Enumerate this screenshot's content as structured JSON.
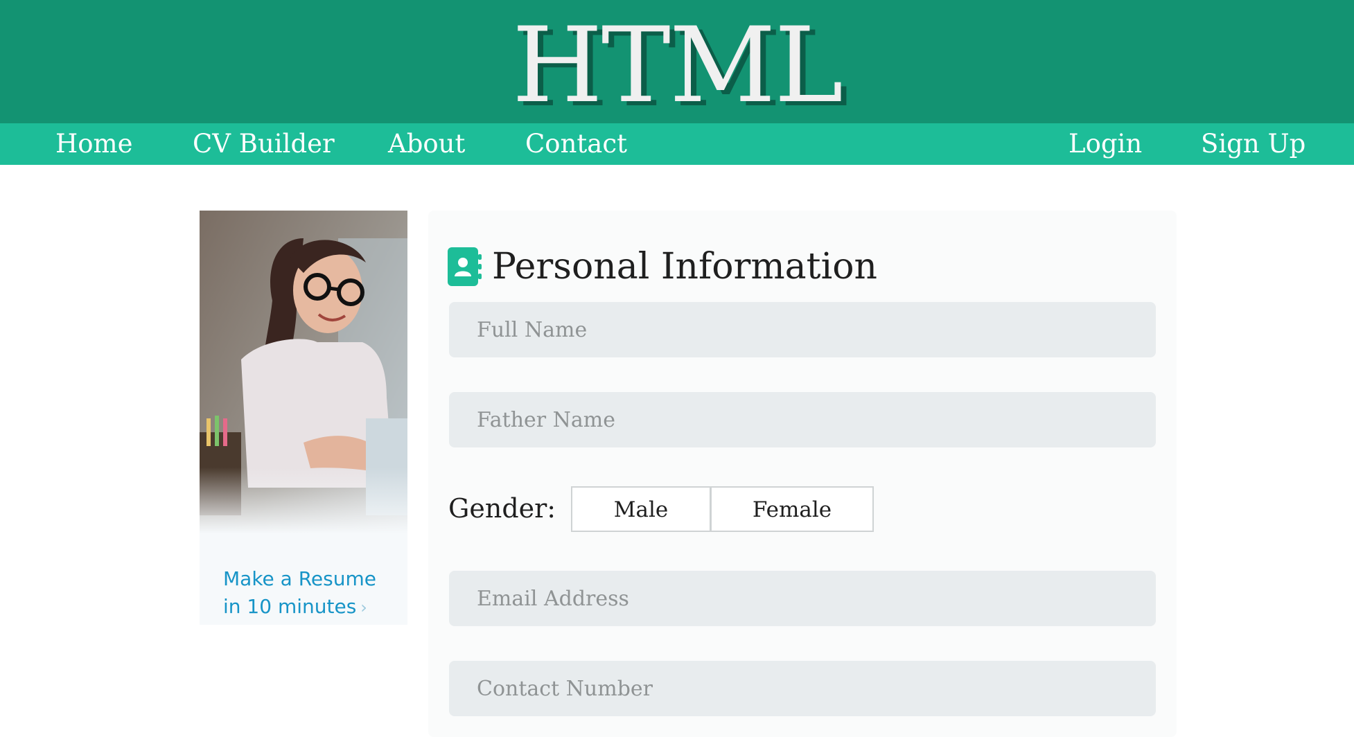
{
  "header": {
    "logo_text": "HTML"
  },
  "nav": {
    "left": [
      "Home",
      "CV Builder",
      "About",
      "Contact"
    ],
    "right": [
      "Login",
      "Sign Up"
    ]
  },
  "promo": {
    "line1": "Make a Resume",
    "line2": "in 10 minutes",
    "chevron": "›"
  },
  "form": {
    "section_icon": "contact-card-icon",
    "title": "Personal Information",
    "fields": {
      "full_name": "Full Name",
      "father_name": "Father Name",
      "email": "Email Address",
      "contact": "Contact Number"
    },
    "gender": {
      "label": "Gender:",
      "options": [
        "Male",
        "Female"
      ]
    }
  },
  "colors": {
    "header_bg": "#139372",
    "nav_bg": "#1dbd98",
    "accent": "#1dbd98",
    "promo_link": "#1794c7"
  }
}
